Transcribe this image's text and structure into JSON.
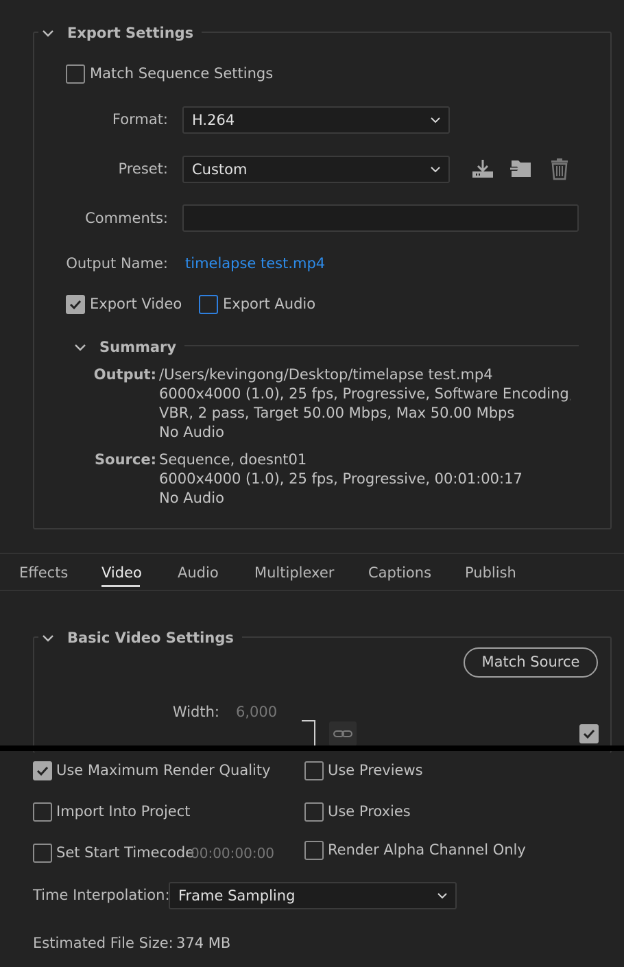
{
  "export_settings": {
    "title": "Export Settings",
    "match_sequence_label": "Match Sequence Settings",
    "format_label": "Format:",
    "format_value": "H.264",
    "preset_label": "Preset:",
    "preset_value": "Custom",
    "comments_label": "Comments:",
    "comments_value": "",
    "output_name_label": "Output Name:",
    "output_name_value": "timelapse test.mp4",
    "export_video_label": "Export Video",
    "export_audio_label": "Export Audio",
    "icons": [
      "save-preset-icon",
      "import-preset-icon",
      "delete-preset-icon"
    ]
  },
  "summary": {
    "title": "Summary",
    "output_key": "Output:",
    "output_lines": [
      "/Users/kevingong/Desktop/timelapse test.mp4",
      "6000x4000 (1.0), 25 fps, Progressive, Software Encoding, 00:...",
      "VBR, 2 pass, Target 50.00 Mbps, Max 50.00 Mbps",
      "No Audio"
    ],
    "source_key": "Source:",
    "source_lines": [
      "Sequence, doesnt01",
      "6000x4000 (1.0), 25 fps, Progressive, 00:01:00:17",
      "No Audio"
    ]
  },
  "tabs": [
    "Effects",
    "Video",
    "Audio",
    "Multiplexer",
    "Captions",
    "Publish"
  ],
  "active_tab": "Video",
  "basic_video": {
    "title": "Basic Video Settings",
    "match_source_label": "Match Source",
    "width_label": "Width:",
    "width_value": "6,000"
  },
  "bottom": {
    "use_max_render_label": "Use Maximum Render Quality",
    "use_previews_label": "Use Previews",
    "import_into_project_label": "Import Into Project",
    "use_proxies_label": "Use Proxies",
    "set_start_timecode_label": "Set Start Timecode",
    "start_timecode_value": "00:00:00:00",
    "render_alpha_label": "Render Alpha Channel Only",
    "time_interp_label": "Time Interpolation:",
    "time_interp_value": "Frame Sampling",
    "est_size_label": "Estimated File Size:",
    "est_size_value": "374 MB"
  },
  "colors": {
    "background": "#232323",
    "accent_link": "#2d8ceb",
    "focus_border": "#2e7fde"
  }
}
